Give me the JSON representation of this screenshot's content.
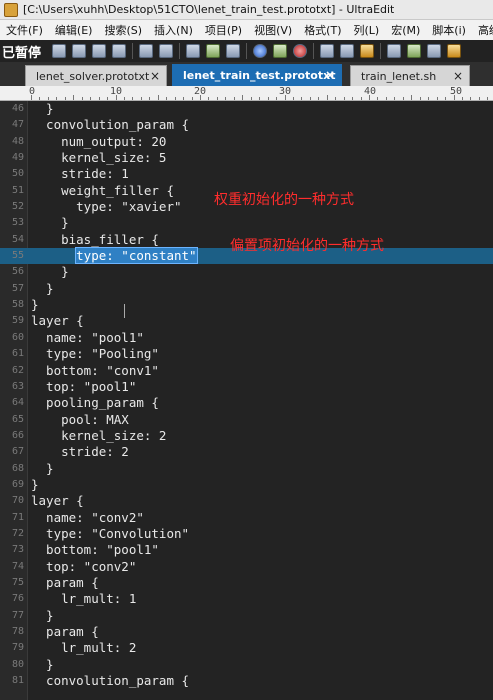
{
  "window": {
    "title": "[C:\\Users\\xuhh\\Desktop\\51CTO\\lenet_train_test.prototxt] - UltraEdit"
  },
  "menu": [
    "文件(F)",
    "编辑(E)",
    "搜索(S)",
    "插入(N)",
    "项目(P)",
    "视图(V)",
    "格式(T)",
    "列(L)",
    "宏(M)",
    "脚本(i)",
    "高级(A)"
  ],
  "toolbar": {
    "paused_label": "已暂停"
  },
  "tabs": [
    {
      "label": "lenet_solver.prototxt",
      "close": "×"
    },
    {
      "label": "lenet_train_test.prototxt",
      "close": "×"
    },
    {
      "label": "train_lenet.sh",
      "close": "×"
    }
  ],
  "ruler": {
    "ticks": [
      "0",
      "10",
      "20",
      "30",
      "40",
      "50"
    ]
  },
  "code_lines": [
    {
      "n": "46",
      "t": "  }"
    },
    {
      "n": "47",
      "t": "  convolution_param {"
    },
    {
      "n": "48",
      "t": "    num_output: 20"
    },
    {
      "n": "49",
      "t": "    kernel_size: 5"
    },
    {
      "n": "50",
      "t": "    stride: 1"
    },
    {
      "n": "51",
      "t": "    weight_filler {"
    },
    {
      "n": "52",
      "t": "      type: \"xavier\""
    },
    {
      "n": "53",
      "t": "    }"
    },
    {
      "n": "54",
      "t": "    bias_filler {"
    },
    {
      "n": "55",
      "t": "      type: \"constant\""
    },
    {
      "n": "56",
      "t": "    }"
    },
    {
      "n": "57",
      "t": "  }"
    },
    {
      "n": "58",
      "t": "}"
    },
    {
      "n": "59",
      "t": "layer {"
    },
    {
      "n": "60",
      "t": "  name: \"pool1\""
    },
    {
      "n": "61",
      "t": "  type: \"Pooling\""
    },
    {
      "n": "62",
      "t": "  bottom: \"conv1\""
    },
    {
      "n": "63",
      "t": "  top: \"pool1\""
    },
    {
      "n": "64",
      "t": "  pooling_param {"
    },
    {
      "n": "65",
      "t": "    pool: MAX"
    },
    {
      "n": "66",
      "t": "    kernel_size: 2"
    },
    {
      "n": "67",
      "t": "    stride: 2"
    },
    {
      "n": "68",
      "t": "  }"
    },
    {
      "n": "69",
      "t": "}"
    },
    {
      "n": "70",
      "t": "layer {"
    },
    {
      "n": "71",
      "t": "  name: \"conv2\""
    },
    {
      "n": "72",
      "t": "  type: \"Convolution\""
    },
    {
      "n": "73",
      "t": "  bottom: \"pool1\""
    },
    {
      "n": "74",
      "t": "  top: \"conv2\""
    },
    {
      "n": "75",
      "t": "  param {"
    },
    {
      "n": "76",
      "t": "    lr_mult: 1"
    },
    {
      "n": "77",
      "t": "  }"
    },
    {
      "n": "78",
      "t": "  param {"
    },
    {
      "n": "79",
      "t": "    lr_mult: 2"
    },
    {
      "n": "80",
      "t": "  }"
    },
    {
      "n": "81",
      "t": "  convolution_param {"
    }
  ],
  "highlighted_line": "55",
  "selected_text": "type: \"constant\"",
  "annotations": {
    "weight_filler_note": "权重初始化的一种方式",
    "bias_filler_note": "偏置项初始化的一种方式"
  },
  "colors": {
    "annotation": "#ff2d2d",
    "active_tab": "#1d6db3",
    "selection": "#2f80c4",
    "editor_bg": "#232323"
  }
}
